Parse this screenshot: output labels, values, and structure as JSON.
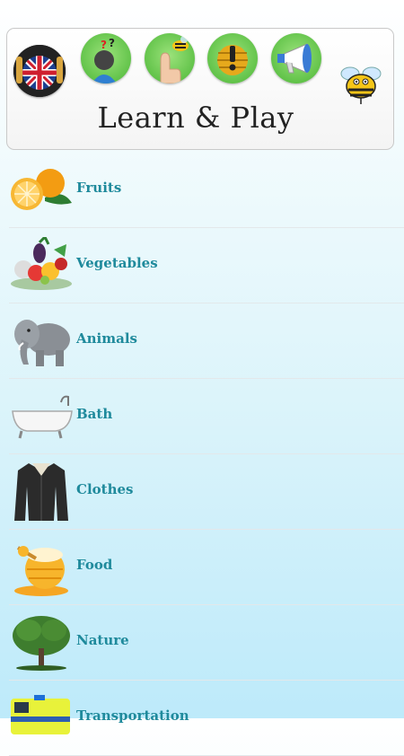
{
  "header": {
    "title": "Learn & Play",
    "buttons": [
      {
        "name": "uk-flag-headphones-icon"
      },
      {
        "name": "quiz-question-icon"
      },
      {
        "name": "touch-bee-icon"
      },
      {
        "name": "bee-hive-alert-icon"
      },
      {
        "name": "megaphone-icon"
      }
    ]
  },
  "categories": [
    {
      "label": "Fruits",
      "icon": "orange-fruit-icon"
    },
    {
      "label": "Vegetables",
      "icon": "vegetables-icon"
    },
    {
      "label": "Animals",
      "icon": "elephant-icon"
    },
    {
      "label": "Bath",
      "icon": "bathtub-icon"
    },
    {
      "label": "Clothes",
      "icon": "jacket-icon"
    },
    {
      "label": "Food",
      "icon": "honey-pot-icon"
    },
    {
      "label": "Nature",
      "icon": "tree-icon"
    },
    {
      "label": "Transportation",
      "icon": "ambulance-icon"
    }
  ],
  "colors": {
    "label": "#1f8a9c",
    "button_green": "#62c34a"
  }
}
